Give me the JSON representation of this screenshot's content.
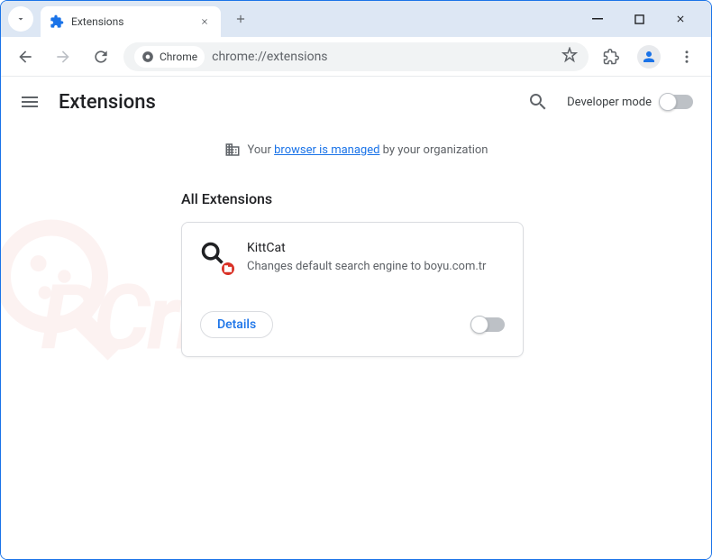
{
  "tab": {
    "title": "Extensions"
  },
  "omnibox": {
    "chip_label": "Chrome",
    "url": "chrome://extensions"
  },
  "page": {
    "title": "Extensions",
    "dev_mode_label": "Developer mode",
    "managed_prefix": "Your ",
    "managed_link": "browser is managed",
    "managed_suffix": " by your organization",
    "section_title": "All Extensions"
  },
  "extension": {
    "name": "KittCat",
    "description": "Changes default search engine to boyu.com.tr",
    "details_label": "Details"
  },
  "watermark": {
    "text": "PCrisk.com"
  }
}
